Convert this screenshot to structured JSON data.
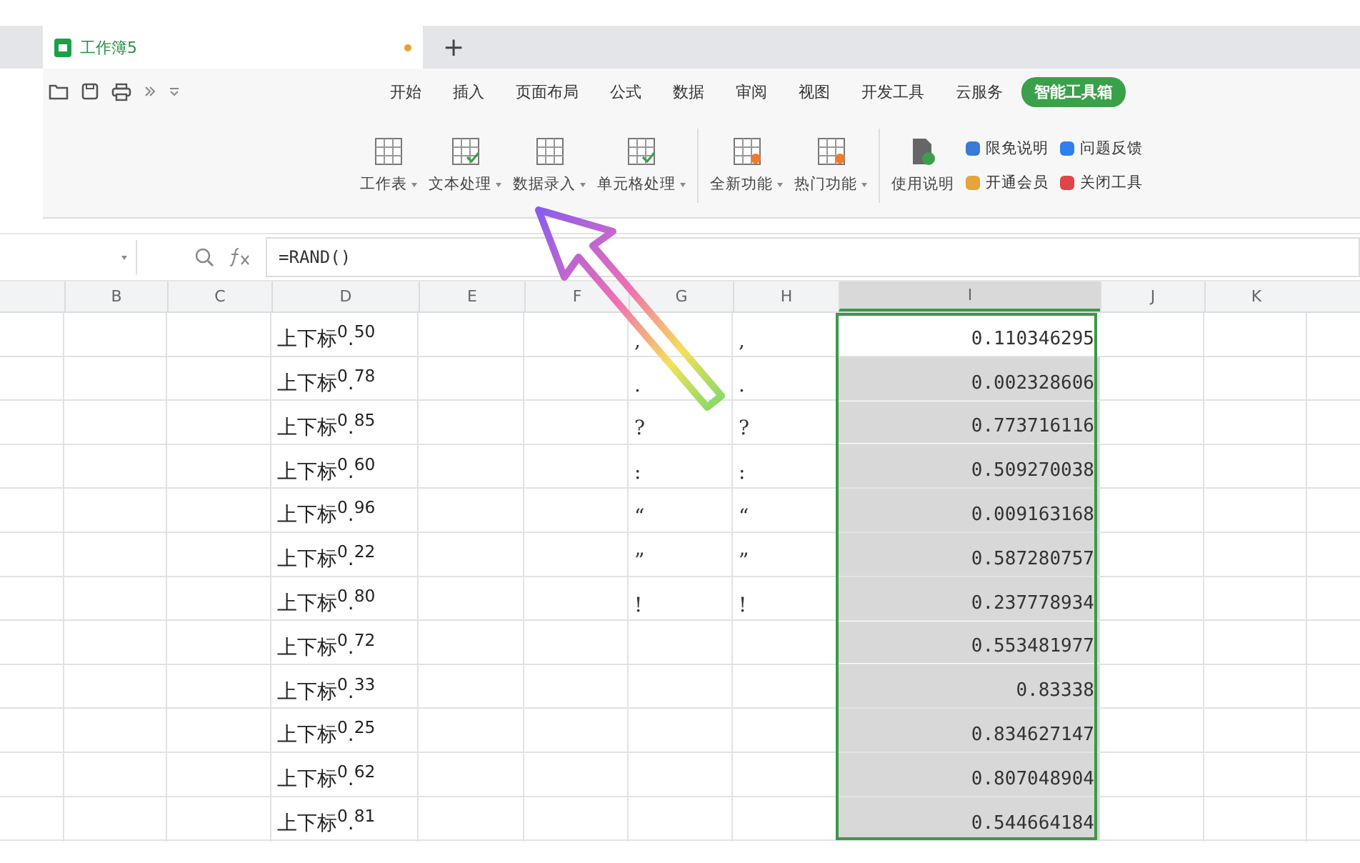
{
  "document_tab": {
    "title": "工作簿5",
    "modified": true
  },
  "new_tab_button": "+",
  "menu_tabs": [
    {
      "label": "开始",
      "selected": false
    },
    {
      "label": "插入",
      "selected": false
    },
    {
      "label": "页面布局",
      "selected": false
    },
    {
      "label": "公式",
      "selected": false
    },
    {
      "label": "数据",
      "selected": false
    },
    {
      "label": "审阅",
      "selected": false
    },
    {
      "label": "视图",
      "selected": false
    },
    {
      "label": "开发工具",
      "selected": false
    },
    {
      "label": "云服务",
      "selected": false
    },
    {
      "label": "智能工具箱",
      "selected": true
    }
  ],
  "ribbon_groups": [
    {
      "buttons": [
        {
          "label": "工作表",
          "dropdown": true
        },
        {
          "label": "文本处理",
          "dropdown": true
        },
        {
          "label": "数据录入",
          "dropdown": true
        },
        {
          "label": "单元格处理",
          "dropdown": true
        }
      ]
    },
    {
      "buttons": [
        {
          "label": "全新功能",
          "dropdown": true
        },
        {
          "label": "热门功能",
          "dropdown": true
        }
      ]
    },
    {
      "buttons": [
        {
          "label": "使用说明",
          "dropdown": false
        }
      ]
    }
  ],
  "small_buttons": [
    {
      "label": "限免说明"
    },
    {
      "label": "问题反馈"
    },
    {
      "label": "开通会员"
    },
    {
      "label": "关闭工具"
    }
  ],
  "formula_bar": {
    "formula": "=RAND()"
  },
  "columns": [
    {
      "label": "B",
      "selected": false
    },
    {
      "label": "C",
      "selected": false
    },
    {
      "label": "D",
      "selected": false
    },
    {
      "label": "E",
      "selected": false
    },
    {
      "label": "F",
      "selected": false
    },
    {
      "label": "G",
      "selected": false
    },
    {
      "label": "H",
      "selected": false
    },
    {
      "label": "I",
      "selected": true
    },
    {
      "label": "J",
      "selected": false
    },
    {
      "label": "K",
      "selected": false
    }
  ],
  "rows": [
    {
      "d": "上下标$^{0}$.$^{50}$",
      "g": ",",
      "h": ",",
      "i": "0.110346295",
      "active": true
    },
    {
      "d": "上下标$^{0}$.$^{78}$",
      "g": ".",
      "h": ".",
      "i": "0.002328606",
      "active": false
    },
    {
      "d": "上下标$^{0}$.$^{85}$",
      "g": "?",
      "h": "?",
      "i": "0.773716116",
      "active": false
    },
    {
      "d": "上下标$^{0}$.$^{60}$",
      "g": ":",
      "h": ":",
      "i": "0.509270038",
      "active": false
    },
    {
      "d": "上下标$^{0}$.$^{96}$",
      "g": "“",
      "h": "“",
      "i": "0.009163168",
      "active": false
    },
    {
      "d": "上下标$^{0}$.$^{22}$",
      "g": "”",
      "h": "”",
      "i": "0.587280757",
      "active": false
    },
    {
      "d": "上下标$^{0}$.$^{80}$",
      "g": "!",
      "h": "!",
      "i": "0.237778934",
      "active": false
    },
    {
      "d": "上下标$^{0}$.$^{72}$",
      "i": "0.553481977",
      "active": false
    },
    {
      "d": "上下标$^{0}$.$^{33}$",
      "i": "0.83338",
      "active": false
    },
    {
      "d": "上下标$^{0}$.$^{25}$",
      "i": "0.834627147",
      "active": false
    },
    {
      "d": "上下标$^{0}$.$^{62}$",
      "i": "0.807048904",
      "active": false
    },
    {
      "d": "上下标$^{0}$.$^{81}$",
      "i": "0.544664184",
      "active": false
    }
  ]
}
